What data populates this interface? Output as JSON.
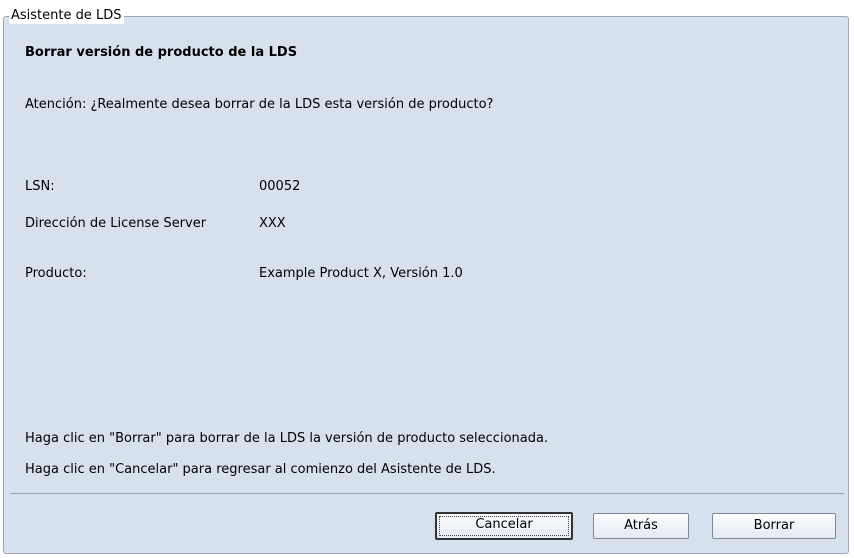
{
  "wizard": {
    "group_title": "Asistente de LDS",
    "heading": "Borrar versión de producto de la LDS",
    "warning": "Atención: ¿Realmente desea borrar de la LDS esta versión de producto?",
    "fields": {
      "lsn_label": "LSN:",
      "lsn_value": "00052",
      "server_label": "Dirección de License Server",
      "server_value": "XXX",
      "product_label": "Producto:",
      "product_value": "Example Product X, Versión 1.0"
    },
    "instructions": {
      "delete_hint": "Haga clic en \"Borrar\" para borrar de la LDS la versión de producto seleccionada.",
      "cancel_hint": "Haga clic en \"Cancelar\" para regresar al comienzo del Asistente de LDS."
    },
    "buttons": {
      "cancel": "Cancelar",
      "back": "Atrás",
      "delete": "Borrar"
    }
  }
}
